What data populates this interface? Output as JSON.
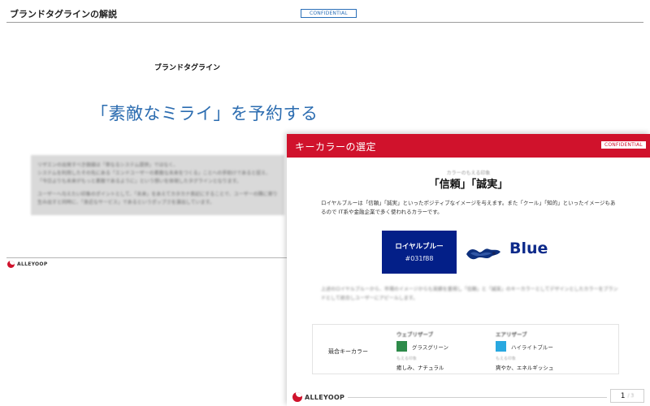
{
  "back_slide": {
    "title": "ブランドタグラインの解説",
    "confidential": "CONFIDENTIAL",
    "subheading": "ブランドタグライン",
    "tagline": "「素敵なミライ」を予約する",
    "body_lines": [
      "リザエンの出発すべき価値は「単なるシステム提供」ではなく、",
      "システムを利用したその先にある「エンドユーザーの素敵な未来をつくる」ことへの手助けであると捉え、",
      "「今日よりも未来がもっと素敵であるように」という想いを体現したタグラインとなります。",
      "ユーザーへ与えたい印象のポイントとして、「未来」をあえてカタカナ表記にすることで、ユーザーの隣に寄り添い",
      "生み出すと同時に、「身近なサービス」であるというポップさを演出しています。"
    ],
    "logo_text": "ALLEYOOP"
  },
  "front_slide": {
    "title": "キーカラーの選定",
    "confidential": "CONFIDENTIAL",
    "kicker": "カラーのもえる印象",
    "heading": "「信頼」「誠実」",
    "description": "ロイヤルブルーは「信頼」「誠実」といったポジティブなイメージを与えます。また「クール」「知的」といったイメージもあるので IT系や金融企業で多く使われるカラーです。",
    "swatch": {
      "name": "ロイヤルブルー",
      "hex": "#031f88",
      "color": "#031f88"
    },
    "color_word": "Blue",
    "blurred_paragraph": "上述のロイヤルブルーから、市場のイメージからも実績を重視し「信頼」と「誠実」のキーカラーとしてデザインとしたカラーをブランドとして統合しユーザーにアピールします。",
    "competitor": {
      "label": "競合キーカラー",
      "columns": [
        {
          "brand": "ウェブリザーブ",
          "color_name": "グラスグリーン",
          "swatch": "#2e8b4a",
          "impression_label": "もえる印象",
          "impression": "癒しみ、ナチュラル"
        },
        {
          "brand": "エアリザーブ",
          "color_name": "ハイライトブルー",
          "swatch": "#29a8e0",
          "impression_label": "もえる印象",
          "impression": "爽やか、エネルギッシュ"
        }
      ]
    },
    "logo_text": "ALLEYOOP",
    "page_current": "1",
    "page_total": "/ 3"
  },
  "colors": {
    "accent_red": "#d0122c",
    "royal_blue": "#031f88",
    "link_blue": "#2b6cb0"
  }
}
